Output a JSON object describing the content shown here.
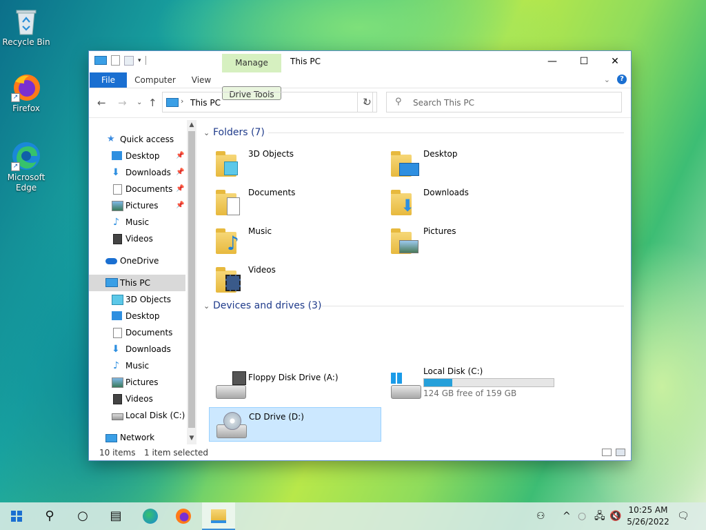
{
  "desktop": {
    "icons": [
      {
        "label": "Recycle Bin"
      },
      {
        "label": "Firefox"
      },
      {
        "label": "Microsoft Edge"
      }
    ]
  },
  "window": {
    "title": "This PC",
    "manage_tab": "Manage",
    "tabs": [
      "File",
      "Computer",
      "View",
      "Drive Tools"
    ],
    "address": "This PC",
    "search_placeholder": "Search This PC",
    "status_items": "10 items",
    "status_selected": "1 item selected"
  },
  "navpane": {
    "quick_access": "Quick access",
    "quick_items": [
      "Desktop",
      "Downloads",
      "Documents",
      "Pictures",
      "Music",
      "Videos"
    ],
    "onedrive": "OneDrive",
    "this_pc": "This PC",
    "pc_items": [
      "3D Objects",
      "Desktop",
      "Documents",
      "Downloads",
      "Music",
      "Pictures",
      "Videos",
      "Local Disk (C:)"
    ],
    "network": "Network"
  },
  "content": {
    "folders_header": "Folders (7)",
    "folders": [
      "3D Objects",
      "Desktop",
      "Documents",
      "Downloads",
      "Music",
      "Pictures",
      "Videos"
    ],
    "devices_header": "Devices and drives (3)",
    "devices": [
      {
        "name": "Floppy Disk Drive (A:)"
      },
      {
        "name": "Local Disk (C:)",
        "free": "124 GB free of 159 GB",
        "used_fraction": 0.22
      },
      {
        "name": "CD Drive (D:)"
      }
    ]
  },
  "taskbar": {
    "time": "10:25 AM",
    "date": "5/26/2022"
  },
  "colors": {
    "accent": "#1a6fd1",
    "selection": "#cce8ff",
    "manage_tab": "#d6f0c0",
    "usage_bar": "#26a0da"
  }
}
